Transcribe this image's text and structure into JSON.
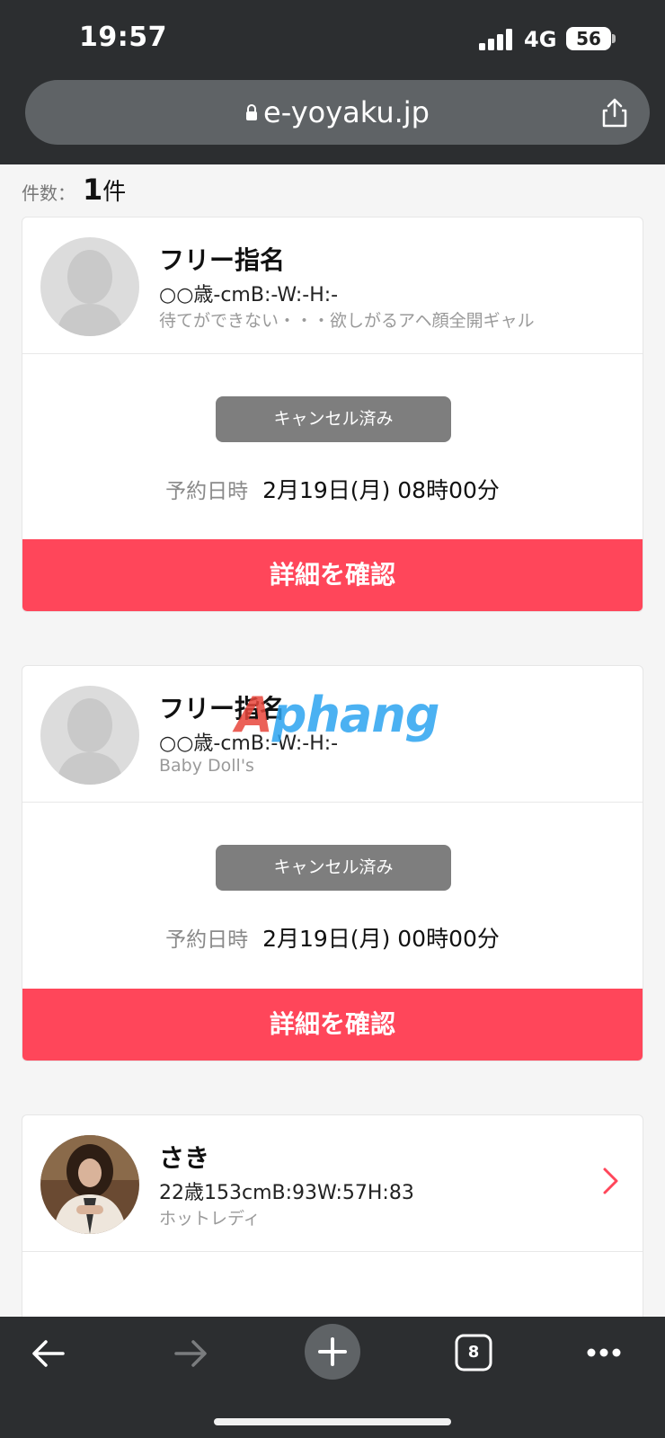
{
  "status_bar": {
    "time": "19:57",
    "network": "4G",
    "battery": "56"
  },
  "browser": {
    "url": "e-yoyaku.jp",
    "tab_count": "8"
  },
  "results": {
    "label": "件数：",
    "count": "1",
    "unit": "件"
  },
  "reservations": [
    {
      "name": "フリー指名",
      "spec": "○○歳-cmB:-W:-H:-",
      "shop": "待てができない・・・欲しがるアヘ顔全開ギャル",
      "status": "キャンセル済み",
      "date_label": "予約日時",
      "date_value": "2月19日(月)  08時00分",
      "detail_button": "詳細を確認"
    },
    {
      "name": "フリー指名",
      "spec": "○○歳-cmB:-W:-H:-",
      "shop": "Baby Doll's",
      "status": "キャンセル済み",
      "date_label": "予約日時",
      "date_value": "2月19日(月)  00時00分",
      "detail_button": "詳細を確認"
    },
    {
      "name": "さき",
      "spec": "22歳153cmB:93W:57H:83",
      "shop": "ホットレディ"
    }
  ],
  "watermark": {
    "first": "A",
    "rest": "phang"
  },
  "colors": {
    "accent": "#ff465a",
    "status_gray": "#7e7e7e",
    "chrome": "#2c2e30"
  },
  "icons": [
    "lock-icon",
    "share-icon",
    "back-icon",
    "forward-icon",
    "new-tab-icon",
    "tabs-icon",
    "more-icon",
    "chevron-right-icon"
  ]
}
